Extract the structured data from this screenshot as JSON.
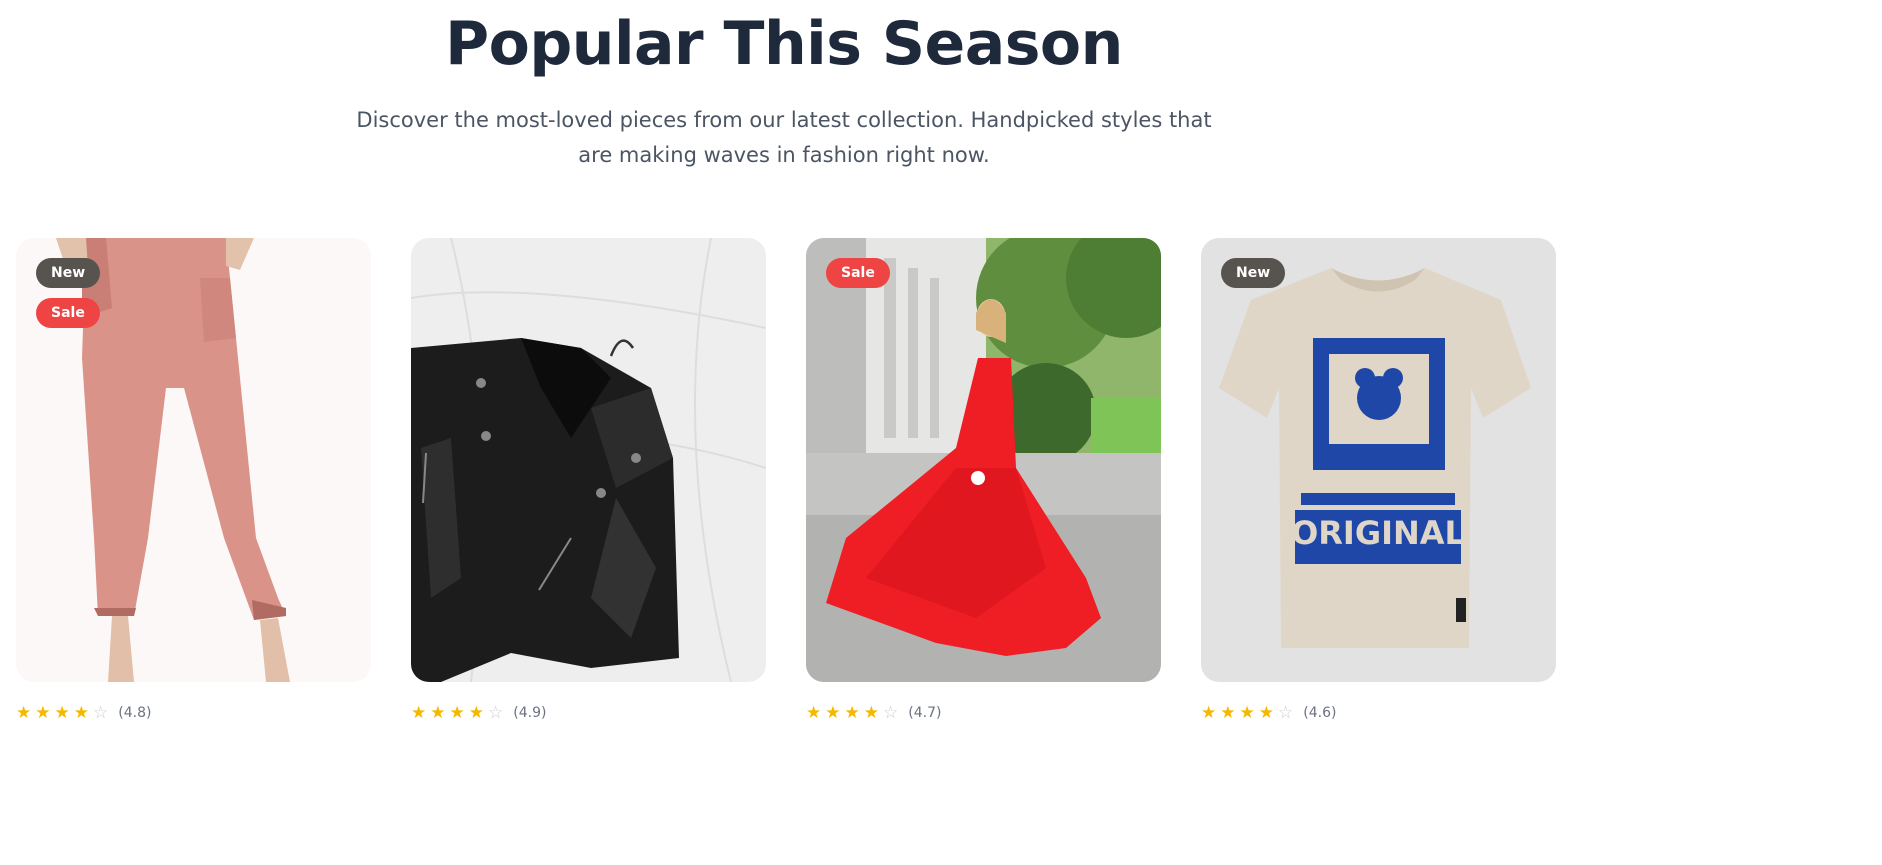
{
  "section": {
    "title": "Popular This Season",
    "subtitle": "Discover the most-loved pieces from our latest collection. Handpicked styles that are making waves in fashion right now."
  },
  "products": [
    {
      "image": "pink-satin-jogger-pants",
      "badges": [
        {
          "label": "New",
          "type": "new"
        },
        {
          "label": "Sale",
          "type": "sale"
        }
      ],
      "stars_filled": 4,
      "stars_total": 5,
      "rating_text": "(4.8)"
    },
    {
      "image": "black-leather-jacket",
      "badges": [],
      "stars_filled": 4,
      "stars_total": 5,
      "rating_text": "(4.9)"
    },
    {
      "image": "red-evening-gown",
      "badges": [
        {
          "label": "Sale",
          "type": "sale"
        }
      ],
      "stars_filled": 4,
      "stars_total": 5,
      "rating_text": "(4.7)"
    },
    {
      "image": "beige-graphic-tshirt",
      "badges": [
        {
          "label": "New",
          "type": "new"
        }
      ],
      "stars_filled": 4,
      "stars_total": 5,
      "rating_text": "(4.6)",
      "shirt_print": "ORIGINAL"
    }
  ],
  "colors": {
    "badge_new": "#57534e",
    "badge_sale": "#ef4444",
    "star": "#f5b800",
    "title": "#1e293b"
  }
}
